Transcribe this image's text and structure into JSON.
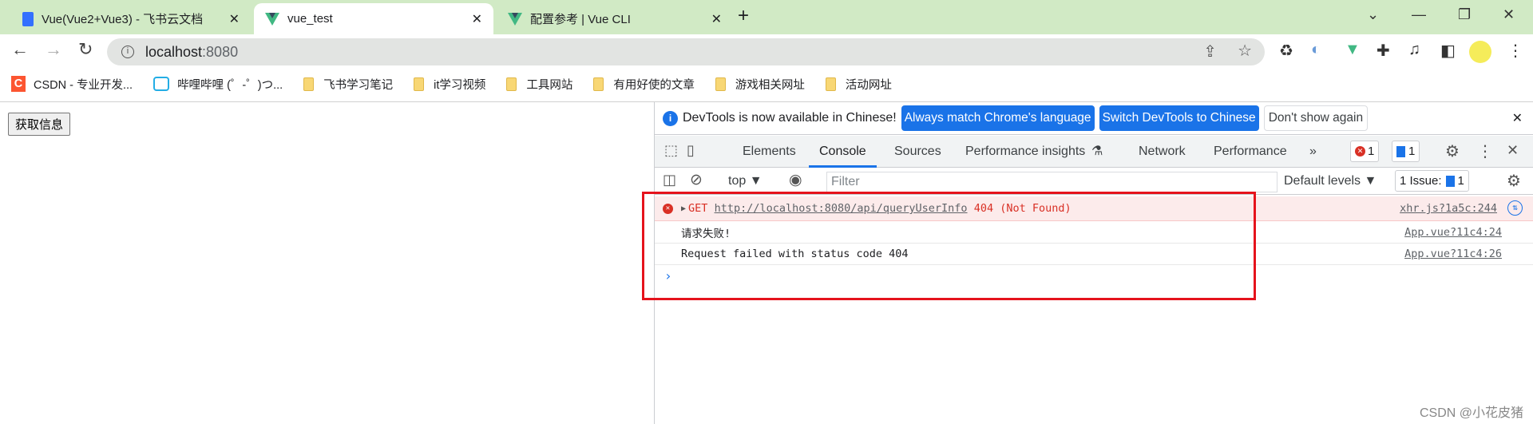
{
  "browser": {
    "tabs": [
      {
        "title": "Vue(Vue2+Vue3) - 飞书云文档",
        "icon": "feishu-doc-icon",
        "active": false
      },
      {
        "title": "vue_test",
        "icon": "vue-icon",
        "active": true
      },
      {
        "title": "配置参考 | Vue CLI",
        "icon": "vue-icon",
        "active": false
      }
    ],
    "new_tab": "+",
    "close": "✕",
    "url_host": "localhost",
    "url_port": ":8080",
    "bookmarks": [
      {
        "label": "CSDN - 专业开发...",
        "icon": "csdn-icon"
      },
      {
        "label": "哔哩哔哩 (゜-゜)つ...",
        "icon": "bilibili-icon"
      },
      {
        "label": "飞书学习笔记",
        "icon": "folder-icon"
      },
      {
        "label": "it学习视频",
        "icon": "folder-icon"
      },
      {
        "label": "工具网站",
        "icon": "folder-icon"
      },
      {
        "label": "有用好使的文章",
        "icon": "folder-icon"
      },
      {
        "label": "游戏相关网址",
        "icon": "folder-icon"
      },
      {
        "label": "活动网址",
        "icon": "folder-icon"
      }
    ]
  },
  "page": {
    "button": "获取信息"
  },
  "devtools": {
    "infobar": {
      "text": "DevTools is now available in Chinese!",
      "btn1": "Always match Chrome's language",
      "btn2": "Switch DevTools to Chinese",
      "btn3": "Don't show again"
    },
    "tabs": [
      "Elements",
      "Console",
      "Sources",
      "Performance insights",
      "Network",
      "Performance"
    ],
    "active_tab": "Console",
    "more": "»",
    "error_count": "1",
    "message_count": "1",
    "context": "top ▼",
    "filter_placeholder": "Filter",
    "levels": "Default levels ▼",
    "issues_label": "1 Issue:",
    "issues_count": "1",
    "console": [
      {
        "type": "error",
        "method": "GET",
        "url": "http://localhost:8080/api/queryUserInfo",
        "status": "404 (Not Found)",
        "source": "xhr.js?1a5c:244"
      },
      {
        "type": "log",
        "text": "请求失败!",
        "source": "App.vue?11c4:24"
      },
      {
        "type": "log",
        "text": "Request failed with status code 404",
        "source": "App.vue?11c4:26"
      }
    ],
    "prompt": "›"
  },
  "watermark": "CSDN @小花皮猪",
  "colors": {
    "tabbar": "#d1eac5",
    "accent": "#1a73e8",
    "error": "#d93025",
    "highlight_box": "#e5131c"
  }
}
